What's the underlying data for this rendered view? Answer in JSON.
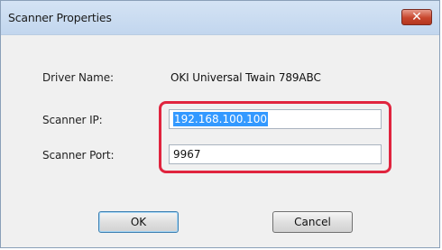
{
  "window": {
    "title": "Scanner Properties",
    "close_glyph": "✕"
  },
  "form": {
    "driver_name_label": "Driver Name:",
    "driver_name_value": "OKI Universal Twain 789ABC",
    "scanner_ip_label": "Scanner IP:",
    "scanner_ip_value": "192.168.100.100",
    "scanner_port_label": "Scanner Port:",
    "scanner_port_value": "9967"
  },
  "buttons": {
    "ok": "OK",
    "cancel": "Cancel"
  },
  "colors": {
    "highlight": "#e0243e",
    "selection": "#3399ff"
  }
}
